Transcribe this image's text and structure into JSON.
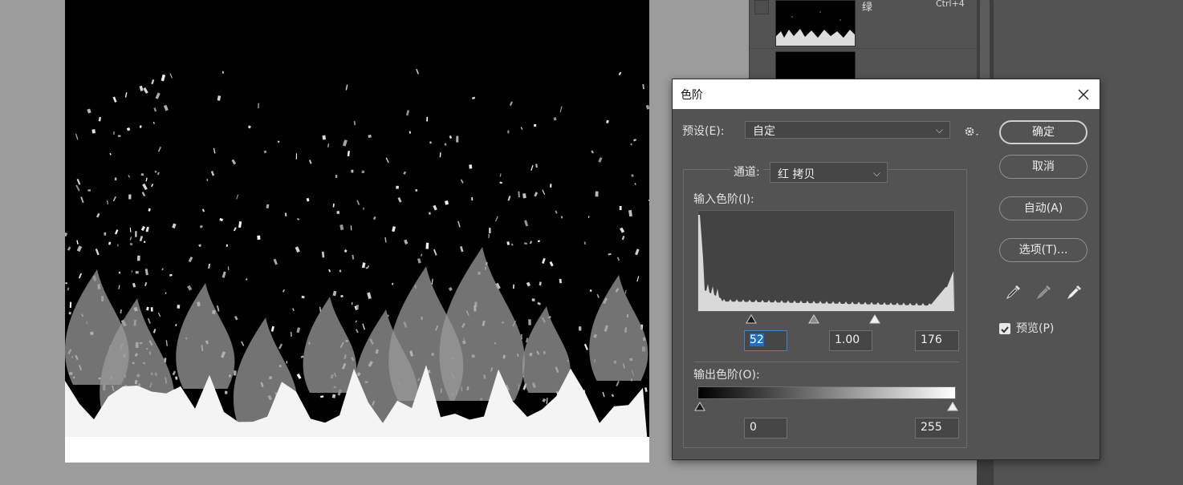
{
  "channels_panel": {
    "rows": [
      {
        "name": "绿",
        "shortcut": "Ctrl+4"
      },
      {
        "name": "",
        "shortcut": ""
      }
    ]
  },
  "dialog": {
    "title": "色阶",
    "preset_label": "预设(E):",
    "preset_value": "自定",
    "channel_label": "通道:",
    "channel_value": "红 拷贝",
    "input_levels_label": "输入色阶(I):",
    "input_black": "52",
    "input_gamma": "1.00",
    "input_white": "176",
    "output_levels_label": "输出色阶(O):",
    "output_black": "0",
    "output_white": "255",
    "buttons": {
      "ok": "确定",
      "cancel": "取消",
      "auto": "自动(A)",
      "options": "选项(T)..."
    },
    "preview_label": "预览(P)",
    "preview_checked": true,
    "eyedroppers": [
      "black-point-eyedropper-icon",
      "gray-point-eyedropper-icon",
      "white-point-eyedropper-icon"
    ],
    "histogram_slider_levels": {
      "black": 52,
      "gamma": 1.0,
      "white": 176
    },
    "accent_color": "#1e6fc8"
  },
  "colors": {
    "workspace": "#9c9c9c",
    "panel": "#535353",
    "dialog_bg": "#535353",
    "titlebar_bg": "#ffffff",
    "canvas_bg": "#000000"
  }
}
